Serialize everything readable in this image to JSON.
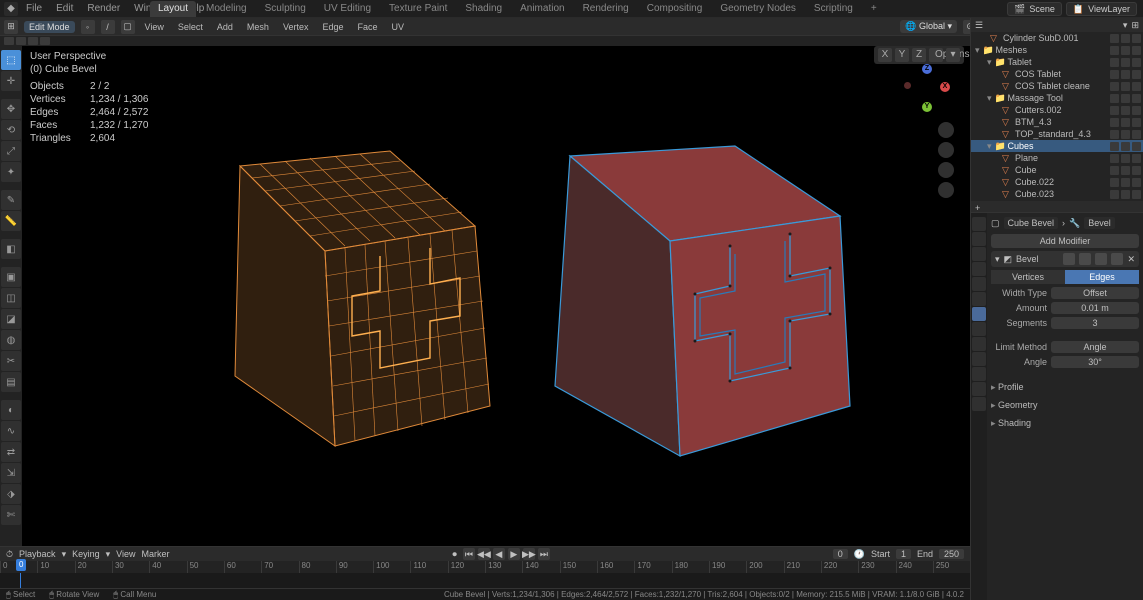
{
  "topmenu": [
    "File",
    "Edit",
    "Render",
    "Window",
    "Help"
  ],
  "workspaces": [
    "Layout",
    "Modeling",
    "Sculpting",
    "UV Editing",
    "Texture Paint",
    "Shading",
    "Animation",
    "Rendering",
    "Compositing",
    "Geometry Nodes",
    "Scripting"
  ],
  "active_workspace": 0,
  "scene": {
    "label": "Scene",
    "viewlayer": "ViewLayer"
  },
  "editor_header": {
    "mode": "Edit Mode",
    "menus": [
      "View",
      "Select",
      "Add",
      "Mesh",
      "Vertex",
      "Edge",
      "Face",
      "UV"
    ],
    "orientation": "Global",
    "snap": false
  },
  "viewport": {
    "overlay": {
      "x": "X",
      "y": "Y",
      "z": "Z",
      "options": "Options"
    },
    "gizmo": {
      "x": "X",
      "y": "Y",
      "z": "Z"
    },
    "stats": {
      "title1": "User Perspective",
      "title2": "(0) Cube Bevel",
      "objects": "2 / 2",
      "verts": "1,234 / 1,306",
      "edges": "2,464 / 2,572",
      "faces": "1,232 / 1,270",
      "tris": "2,604"
    }
  },
  "outliner": {
    "items": [
      {
        "depth": 1,
        "icon": "mesh",
        "label": "Cylinder SubD.001"
      },
      {
        "depth": 0,
        "icon": "coll",
        "label": "Meshes",
        "collapsed": false
      },
      {
        "depth": 1,
        "icon": "coll",
        "label": "Tablet",
        "collapsed": false
      },
      {
        "depth": 2,
        "icon": "mesh",
        "label": "COS Tablet"
      },
      {
        "depth": 2,
        "icon": "mesh",
        "label": "COS Tablet cleane"
      },
      {
        "depth": 1,
        "icon": "coll",
        "label": "Massage Tool",
        "collapsed": false
      },
      {
        "depth": 2,
        "icon": "mesh",
        "label": "Cutters.002"
      },
      {
        "depth": 2,
        "icon": "mesh",
        "label": "BTM_4.3"
      },
      {
        "depth": 2,
        "icon": "mesh",
        "label": "TOP_standard_4.3"
      },
      {
        "depth": 1,
        "icon": "coll",
        "label": "Cubes",
        "highlight": true
      },
      {
        "depth": 2,
        "icon": "mesh",
        "label": "Plane"
      },
      {
        "depth": 2,
        "icon": "mesh",
        "label": "Cube"
      },
      {
        "depth": 2,
        "icon": "mesh",
        "label": "Cube.022"
      },
      {
        "depth": 2,
        "icon": "mesh",
        "label": "Cube.023"
      }
    ],
    "search_placeholder": ""
  },
  "properties": {
    "breadcrumb_obj": "Cube Bevel",
    "breadcrumb_mod": "Bevel",
    "add_modifier": "Add Modifier",
    "mod_name": "Bevel",
    "seg_vertices": "Vertices",
    "seg_edges": "Edges",
    "width_type_lbl": "Width Type",
    "width_type": "Offset",
    "amount_lbl": "Amount",
    "amount": "0.01 m",
    "segments_lbl": "Segments",
    "segments": "3",
    "limit_lbl": "Limit Method",
    "limit": "Angle",
    "angle_lbl": "Angle",
    "angle": "30°",
    "sub1": "Profile",
    "sub2": "Geometry",
    "sub3": "Shading"
  },
  "timeline": {
    "menus": [
      "Playback",
      "Keying",
      "View",
      "Marker"
    ],
    "current": "0",
    "start_lbl": "Start",
    "start": "1",
    "end_lbl": "End",
    "end": "250",
    "ticks": [
      "0",
      "10",
      "20",
      "30",
      "40",
      "50",
      "60",
      "70",
      "80",
      "90",
      "100",
      "110",
      "120",
      "130",
      "140",
      "150",
      "160",
      "170",
      "180",
      "190",
      "200",
      "210",
      "220",
      "230",
      "240",
      "250"
    ]
  },
  "status": {
    "lmb": "Select",
    "mmb": "Rotate View",
    "rmb": "Call Menu",
    "right": "Cube Bevel | Verts:1,234/1,306 | Edges:2,464/2,572 | Faces:1,232/1,270 | Tris:2,604 | Objects:0/2 | Memory: 215.5 MiB | VRAM: 1.1/8.0 GiB | 4.0.2"
  }
}
